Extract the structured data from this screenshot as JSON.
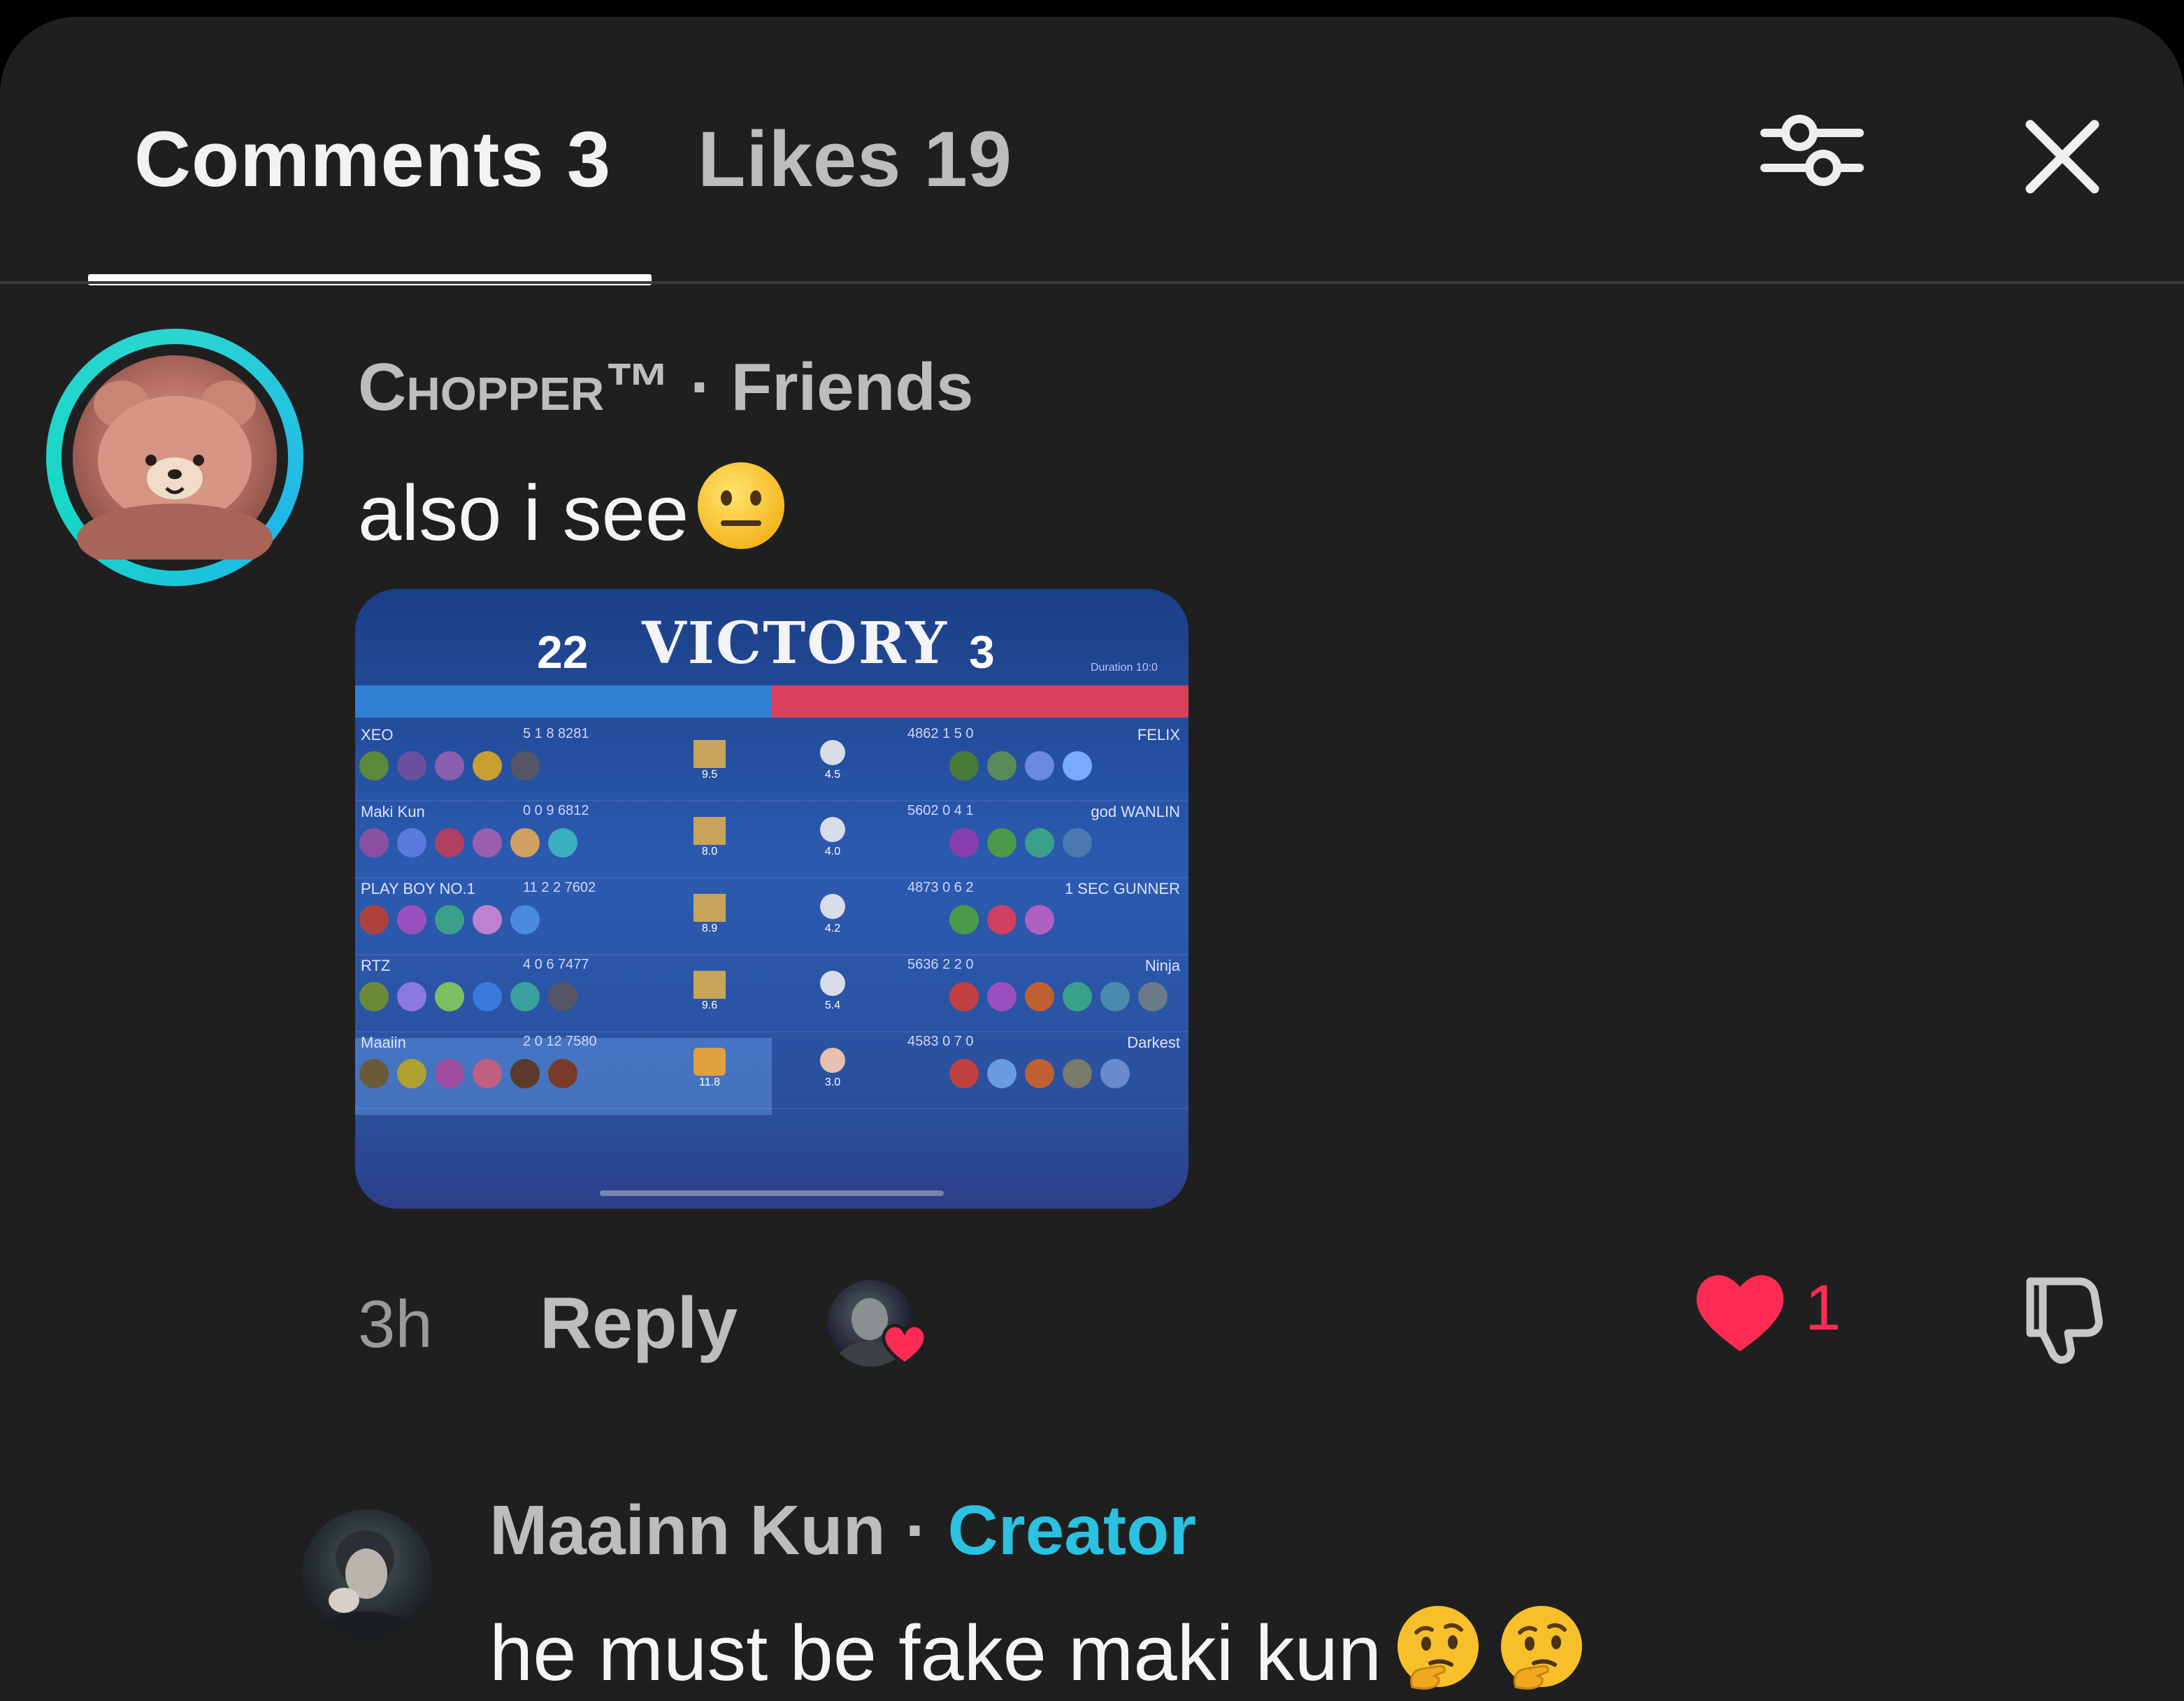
{
  "header": {
    "comments_tab": "Comments 3",
    "likes_tab": "Likes 19",
    "icons": {
      "filter": "filter-sliders-icon",
      "close": "close-icon"
    }
  },
  "comments": [
    {
      "username": "Chopper™",
      "separator": " · ",
      "relation": "Friends",
      "text": "also i see",
      "emoji": "neutral-face-emoji",
      "attachment": {
        "type": "screenshot",
        "headline": "VICTORY",
        "score_left": "22",
        "score_right": "3",
        "duration": "Duration 10:0",
        "rows": [
          {
            "left_name": "XEO",
            "left_kda": "5 1 8",
            "left_gold": "8281",
            "left_rating": "9.5",
            "right_rating": "4.5",
            "right_gold": "4862",
            "right_kda": "1 5 0",
            "right_name": "FELIX"
          },
          {
            "left_name": "Maki Kun",
            "left_kda": "0 0 9",
            "left_gold": "6812",
            "left_rating": "8.0",
            "right_rating": "4.0",
            "right_gold": "5602",
            "right_kda": "0 4 1",
            "right_name": "god WANLIN"
          },
          {
            "left_name": "PLAY BOY NO.1",
            "left_kda": "11 2 2",
            "left_gold": "7602",
            "left_rating": "8.9",
            "right_rating": "4.2",
            "right_gold": "4873",
            "right_kda": "0 6 2",
            "right_name": "1 SEC GUNNER"
          },
          {
            "left_name": "RTZ",
            "left_kda": "4 0 6",
            "left_gold": "7477",
            "left_rating": "9.6",
            "right_rating": "5.4",
            "right_gold": "5636",
            "right_kda": "2 2 0",
            "right_name": "Ninja"
          },
          {
            "left_name": "Maaiin",
            "left_kda": "2 0 12",
            "left_gold": "7580",
            "left_rating": "11.8",
            "right_rating": "3.0",
            "right_gold": "4583",
            "right_kda": "0 7 0",
            "right_name": "Darkest"
          }
        ]
      },
      "time": "3h",
      "reply_label": "Reply",
      "like_count": "1",
      "liked": true
    },
    {
      "username": "Maainn Kun",
      "separator": " · ",
      "badge": "Creator",
      "text": "he must be fake maki kun",
      "emoji": "thinking-face-emoji"
    }
  ],
  "colors": {
    "background": "#1f1f1f",
    "accent_like": "#fe2c55",
    "creator": "#2bc1e0",
    "ring": "#20c4e0"
  }
}
